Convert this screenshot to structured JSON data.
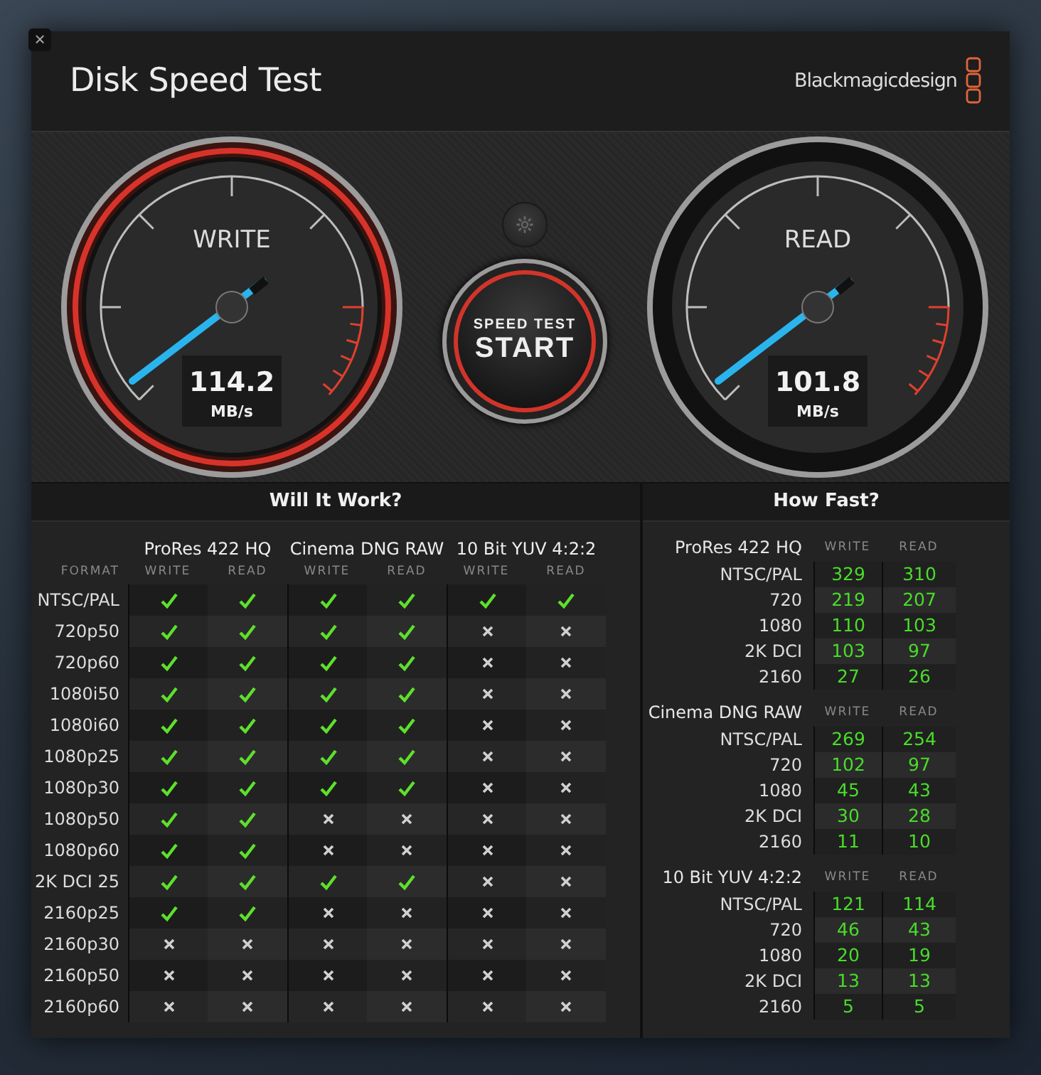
{
  "window": {
    "close": "×",
    "title": "Disk Speed Test",
    "brand": "Blackmagicdesign"
  },
  "gauges": [
    {
      "label": "WRITE",
      "value": "114.2",
      "unit": "MB/s",
      "highlighted": true
    },
    {
      "label": "READ",
      "value": "101.8",
      "unit": "MB/s",
      "highlighted": false
    }
  ],
  "start_button": {
    "caption": "SPEED TEST",
    "label": "START"
  },
  "will_it_work": {
    "title": "Will It Work?",
    "format_header": "FORMAT",
    "codecs": [
      {
        "name": "ProRes 422 HQ",
        "columns": [
          "WRITE",
          "READ"
        ]
      },
      {
        "name": "Cinema DNG RAW",
        "columns": [
          "WRITE",
          "READ"
        ]
      },
      {
        "name": "10 Bit YUV 4:2:2",
        "columns": [
          "WRITE",
          "READ"
        ]
      }
    ],
    "rows": [
      {
        "format": "NTSC/PAL",
        "results": [
          true,
          true,
          true,
          true,
          true,
          true
        ]
      },
      {
        "format": "720p50",
        "results": [
          true,
          true,
          true,
          true,
          false,
          false
        ]
      },
      {
        "format": "720p60",
        "results": [
          true,
          true,
          true,
          true,
          false,
          false
        ]
      },
      {
        "format": "1080i50",
        "results": [
          true,
          true,
          true,
          true,
          false,
          false
        ]
      },
      {
        "format": "1080i60",
        "results": [
          true,
          true,
          true,
          true,
          false,
          false
        ]
      },
      {
        "format": "1080p25",
        "results": [
          true,
          true,
          true,
          true,
          false,
          false
        ]
      },
      {
        "format": "1080p30",
        "results": [
          true,
          true,
          true,
          true,
          false,
          false
        ]
      },
      {
        "format": "1080p50",
        "results": [
          true,
          true,
          false,
          false,
          false,
          false
        ]
      },
      {
        "format": "1080p60",
        "results": [
          true,
          true,
          false,
          false,
          false,
          false
        ]
      },
      {
        "format": "2K DCI 25",
        "results": [
          true,
          true,
          true,
          true,
          false,
          false
        ]
      },
      {
        "format": "2160p25",
        "results": [
          true,
          true,
          false,
          false,
          false,
          false
        ]
      },
      {
        "format": "2160p30",
        "results": [
          false,
          false,
          false,
          false,
          false,
          false
        ]
      },
      {
        "format": "2160p50",
        "results": [
          false,
          false,
          false,
          false,
          false,
          false
        ]
      },
      {
        "format": "2160p60",
        "results": [
          false,
          false,
          false,
          false,
          false,
          false
        ]
      }
    ]
  },
  "how_fast": {
    "title": "How Fast?",
    "groups": [
      {
        "codec": "ProRes 422 HQ",
        "write_header": "WRITE",
        "read_header": "READ",
        "rows": [
          {
            "format": "NTSC/PAL",
            "write": "329",
            "read": "310"
          },
          {
            "format": "720",
            "write": "219",
            "read": "207"
          },
          {
            "format": "1080",
            "write": "110",
            "read": "103"
          },
          {
            "format": "2K DCI",
            "write": "103",
            "read": "97"
          },
          {
            "format": "2160",
            "write": "27",
            "read": "26"
          }
        ]
      },
      {
        "codec": "Cinema DNG RAW",
        "write_header": "WRITE",
        "read_header": "READ",
        "rows": [
          {
            "format": "NTSC/PAL",
            "write": "269",
            "read": "254"
          },
          {
            "format": "720",
            "write": "102",
            "read": "97"
          },
          {
            "format": "1080",
            "write": "45",
            "read": "43"
          },
          {
            "format": "2K DCI",
            "write": "30",
            "read": "28"
          },
          {
            "format": "2160",
            "write": "11",
            "read": "10"
          }
        ]
      },
      {
        "codec": "10 Bit YUV 4:2:2",
        "write_header": "WRITE",
        "read_header": "READ",
        "rows": [
          {
            "format": "NTSC/PAL",
            "write": "121",
            "read": "114"
          },
          {
            "format": "720",
            "write": "46",
            "read": "43"
          },
          {
            "format": "1080",
            "write": "20",
            "read": "19"
          },
          {
            "format": "2K DCI",
            "write": "13",
            "read": "13"
          },
          {
            "format": "2160",
            "write": "5",
            "read": "5"
          }
        ]
      }
    ]
  }
}
